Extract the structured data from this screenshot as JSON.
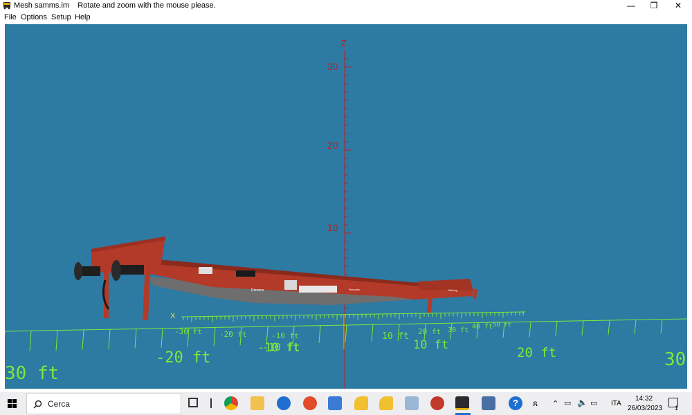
{
  "window": {
    "title": "Mesh samms.im",
    "hint": "Rotate and zoom with the mouse please.",
    "minimize_glyph": "—",
    "restore_glyph": "❐",
    "close_glyph": "✕"
  },
  "menu": [
    "File",
    "Options",
    "Setup",
    "Help"
  ],
  "scene": {
    "background": "#2d7aa3",
    "z_axis_label": "Z",
    "z_ticks": [
      "30",
      "20",
      "10"
    ],
    "x_axis_label": "X",
    "y_axis_label": "Y",
    "grid_labels_back": [
      "-30 ft",
      "-20 ft",
      "-10 ft",
      "20 ft",
      "30 ft",
      "40 ft",
      "50 ft"
    ],
    "grid_labels_mid": [
      "-10 ft",
      "10 ft"
    ],
    "grid_labels_front": [
      "30 ft",
      "-20 ft",
      "-10 ft",
      "10 ft",
      "20 ft",
      "30"
    ],
    "wagon_markings": [
      "Rimmns",
      "Remarks",
      "Gattung"
    ],
    "colors": {
      "axis_z": "#b8202a",
      "grid": "#7fe83a",
      "wagon": "#b33a28",
      "underframe": "#6e6e6e"
    }
  },
  "taskbar": {
    "search_placeholder": "Cerca",
    "language": "ITA",
    "time": "14:32",
    "date": "26/03/2023",
    "notification_count": "1"
  }
}
